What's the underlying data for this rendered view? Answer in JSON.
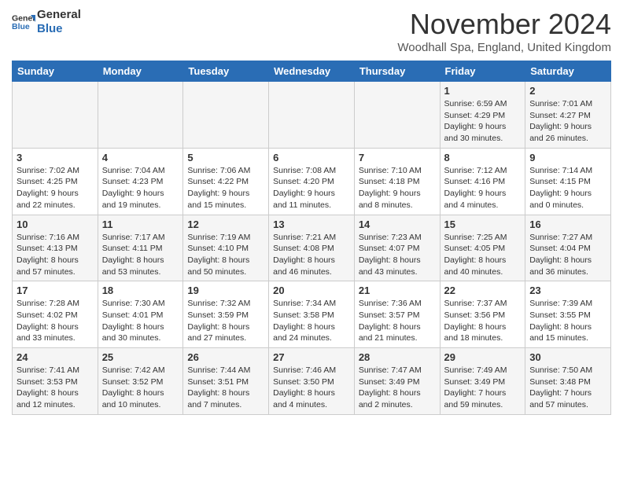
{
  "header": {
    "logo_general": "General",
    "logo_blue": "Blue",
    "month": "November 2024",
    "location": "Woodhall Spa, England, United Kingdom"
  },
  "days_of_week": [
    "Sunday",
    "Monday",
    "Tuesday",
    "Wednesday",
    "Thursday",
    "Friday",
    "Saturday"
  ],
  "weeks": [
    [
      {
        "day": "",
        "info": ""
      },
      {
        "day": "",
        "info": ""
      },
      {
        "day": "",
        "info": ""
      },
      {
        "day": "",
        "info": ""
      },
      {
        "day": "",
        "info": ""
      },
      {
        "day": "1",
        "info": "Sunrise: 6:59 AM\nSunset: 4:29 PM\nDaylight: 9 hours and 30 minutes."
      },
      {
        "day": "2",
        "info": "Sunrise: 7:01 AM\nSunset: 4:27 PM\nDaylight: 9 hours and 26 minutes."
      }
    ],
    [
      {
        "day": "3",
        "info": "Sunrise: 7:02 AM\nSunset: 4:25 PM\nDaylight: 9 hours and 22 minutes."
      },
      {
        "day": "4",
        "info": "Sunrise: 7:04 AM\nSunset: 4:23 PM\nDaylight: 9 hours and 19 minutes."
      },
      {
        "day": "5",
        "info": "Sunrise: 7:06 AM\nSunset: 4:22 PM\nDaylight: 9 hours and 15 minutes."
      },
      {
        "day": "6",
        "info": "Sunrise: 7:08 AM\nSunset: 4:20 PM\nDaylight: 9 hours and 11 minutes."
      },
      {
        "day": "7",
        "info": "Sunrise: 7:10 AM\nSunset: 4:18 PM\nDaylight: 9 hours and 8 minutes."
      },
      {
        "day": "8",
        "info": "Sunrise: 7:12 AM\nSunset: 4:16 PM\nDaylight: 9 hours and 4 minutes."
      },
      {
        "day": "9",
        "info": "Sunrise: 7:14 AM\nSunset: 4:15 PM\nDaylight: 9 hours and 0 minutes."
      }
    ],
    [
      {
        "day": "10",
        "info": "Sunrise: 7:16 AM\nSunset: 4:13 PM\nDaylight: 8 hours and 57 minutes."
      },
      {
        "day": "11",
        "info": "Sunrise: 7:17 AM\nSunset: 4:11 PM\nDaylight: 8 hours and 53 minutes."
      },
      {
        "day": "12",
        "info": "Sunrise: 7:19 AM\nSunset: 4:10 PM\nDaylight: 8 hours and 50 minutes."
      },
      {
        "day": "13",
        "info": "Sunrise: 7:21 AM\nSunset: 4:08 PM\nDaylight: 8 hours and 46 minutes."
      },
      {
        "day": "14",
        "info": "Sunrise: 7:23 AM\nSunset: 4:07 PM\nDaylight: 8 hours and 43 minutes."
      },
      {
        "day": "15",
        "info": "Sunrise: 7:25 AM\nSunset: 4:05 PM\nDaylight: 8 hours and 40 minutes."
      },
      {
        "day": "16",
        "info": "Sunrise: 7:27 AM\nSunset: 4:04 PM\nDaylight: 8 hours and 36 minutes."
      }
    ],
    [
      {
        "day": "17",
        "info": "Sunrise: 7:28 AM\nSunset: 4:02 PM\nDaylight: 8 hours and 33 minutes."
      },
      {
        "day": "18",
        "info": "Sunrise: 7:30 AM\nSunset: 4:01 PM\nDaylight: 8 hours and 30 minutes."
      },
      {
        "day": "19",
        "info": "Sunrise: 7:32 AM\nSunset: 3:59 PM\nDaylight: 8 hours and 27 minutes."
      },
      {
        "day": "20",
        "info": "Sunrise: 7:34 AM\nSunset: 3:58 PM\nDaylight: 8 hours and 24 minutes."
      },
      {
        "day": "21",
        "info": "Sunrise: 7:36 AM\nSunset: 3:57 PM\nDaylight: 8 hours and 21 minutes."
      },
      {
        "day": "22",
        "info": "Sunrise: 7:37 AM\nSunset: 3:56 PM\nDaylight: 8 hours and 18 minutes."
      },
      {
        "day": "23",
        "info": "Sunrise: 7:39 AM\nSunset: 3:55 PM\nDaylight: 8 hours and 15 minutes."
      }
    ],
    [
      {
        "day": "24",
        "info": "Sunrise: 7:41 AM\nSunset: 3:53 PM\nDaylight: 8 hours and 12 minutes."
      },
      {
        "day": "25",
        "info": "Sunrise: 7:42 AM\nSunset: 3:52 PM\nDaylight: 8 hours and 10 minutes."
      },
      {
        "day": "26",
        "info": "Sunrise: 7:44 AM\nSunset: 3:51 PM\nDaylight: 8 hours and 7 minutes."
      },
      {
        "day": "27",
        "info": "Sunrise: 7:46 AM\nSunset: 3:50 PM\nDaylight: 8 hours and 4 minutes."
      },
      {
        "day": "28",
        "info": "Sunrise: 7:47 AM\nSunset: 3:49 PM\nDaylight: 8 hours and 2 minutes."
      },
      {
        "day": "29",
        "info": "Sunrise: 7:49 AM\nSunset: 3:49 PM\nDaylight: 7 hours and 59 minutes."
      },
      {
        "day": "30",
        "info": "Sunrise: 7:50 AM\nSunset: 3:48 PM\nDaylight: 7 hours and 57 minutes."
      }
    ]
  ]
}
